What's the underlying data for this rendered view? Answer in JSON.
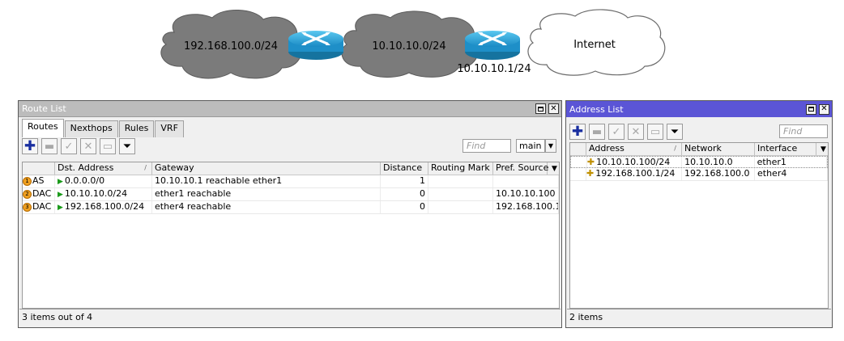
{
  "diagram": {
    "clouds": [
      "192.168.100.0/24",
      "10.10.10.0/24",
      "Internet"
    ],
    "gateway_ip": "10.10.10.1/24"
  },
  "route_list": {
    "title": "Route List",
    "tabs": [
      "Routes",
      "Nexthops",
      "Rules",
      "VRF"
    ],
    "find_placeholder": "Find",
    "table_select": "main",
    "columns": [
      "",
      "Dst. Address",
      "Gateway",
      "Distance",
      "Routing Mark",
      "Pref. Source"
    ],
    "rows": [
      {
        "badge": "1",
        "flags": "AS",
        "dst": "0.0.0.0/0",
        "gateway": "10.10.10.1 reachable ether1",
        "distance": "1",
        "mark": "",
        "pref_source": ""
      },
      {
        "badge": "2",
        "flags": "DAC",
        "dst": "10.10.10.0/24",
        "gateway": "ether1 reachable",
        "distance": "0",
        "mark": "",
        "pref_source": "10.10.10.100"
      },
      {
        "badge": "3",
        "flags": "DAC",
        "dst": "192.168.100.0/24",
        "gateway": "ether4 reachable",
        "distance": "0",
        "mark": "",
        "pref_source": "192.168.100.1"
      }
    ],
    "status": "3 items out of 4"
  },
  "address_list": {
    "title": "Address List",
    "find_placeholder": "Find",
    "columns": [
      "Address",
      "Network",
      "Interface"
    ],
    "rows": [
      {
        "address": "10.10.10.100/24",
        "network": "10.10.10.0",
        "interface": "ether1"
      },
      {
        "address": "192.168.100.1/24",
        "network": "192.168.100.0",
        "interface": "ether4"
      }
    ],
    "status": "2 items"
  },
  "colors": {
    "address_titlebar": "#5b55d6",
    "route_titlebar": "#bcbcbc",
    "cloud_dark": "#7d7d7d",
    "router_blue": "#1e8fc8"
  }
}
